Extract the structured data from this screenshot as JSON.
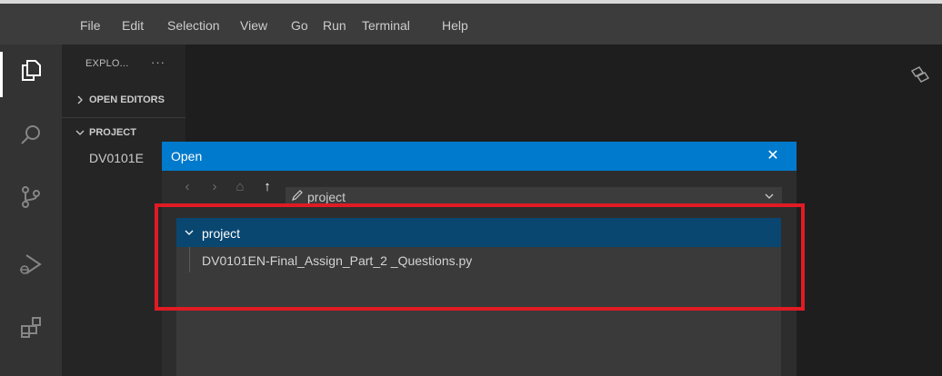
{
  "menu": {
    "items": [
      "File",
      "Edit",
      "Selection",
      "View",
      "Go",
      "Run",
      "Terminal",
      "Help"
    ]
  },
  "activity_bar": {
    "icons": [
      "explorer-icon",
      "search-icon",
      "source-control-icon",
      "run-debug-icon",
      "extensions-icon"
    ]
  },
  "sidebar": {
    "title": "EXPLO...",
    "more": "···",
    "open_editors": "OPEN EDITORS",
    "project": "PROJECT",
    "file_truncated": "DV0101E"
  },
  "dialog": {
    "title": "Open",
    "close": "✕",
    "path": "project",
    "nav": {
      "back": "‹",
      "forward": "›",
      "home": "⌂",
      "up": "↑"
    }
  },
  "tree": {
    "folder": "project",
    "file": "DV0101EN-Final_Assign_Part_2 _Questions.py"
  },
  "colors": {
    "accent": "#007acc",
    "selection": "#094771",
    "highlight": "#e01b24"
  }
}
